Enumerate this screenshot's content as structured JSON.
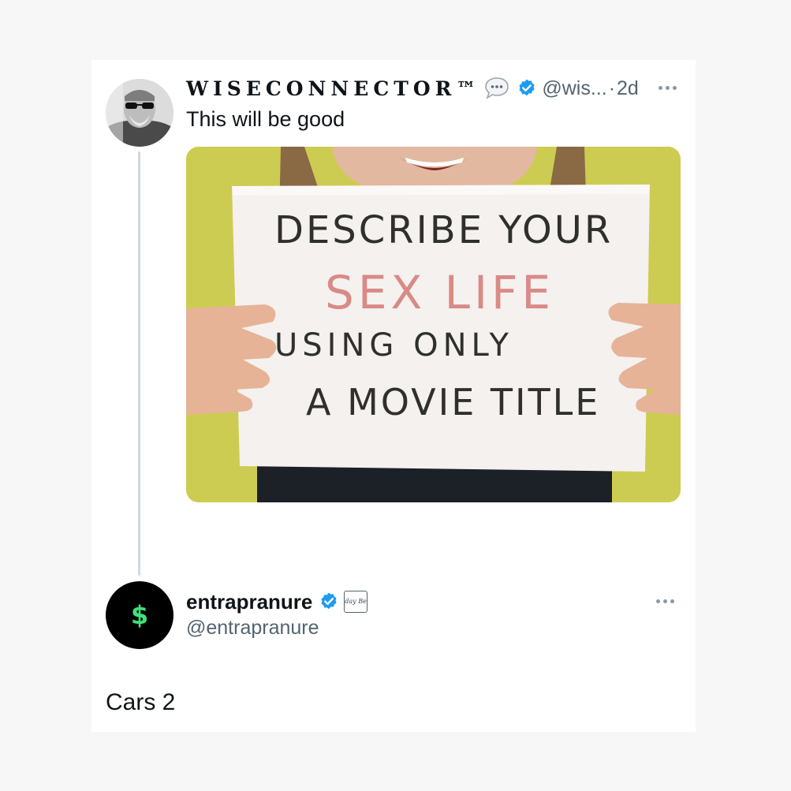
{
  "tweet": {
    "author": {
      "display_name": "WISECONNECTOR™",
      "handle": "@wis...",
      "separator": "·",
      "time": "2d",
      "verified": true,
      "icons": [
        "speech-bubble-icon",
        "verified-badge-icon"
      ]
    },
    "text": "This will be good",
    "media": {
      "sign_lines": [
        "DESCRIBE YOUR",
        "SEX LIFE",
        "USING ONLY",
        "A MOVIE TITLE"
      ],
      "colors": {
        "background": "#c9c84f",
        "sign": "#f4f1ee",
        "ink_dark": "#2f302d",
        "ink_red": "#d98a88"
      }
    }
  },
  "reply": {
    "author": {
      "display_name": "entrapranure",
      "handle": "@entrapranure",
      "verified": true,
      "affiliate_badge_text": "Friday Beers",
      "avatar_symbol": "$"
    },
    "text": "Cars 2"
  },
  "colors": {
    "page_bg": "#f7f7f7",
    "card_bg": "#ffffff",
    "verified_blue": "#1d9bf0",
    "muted_text": "#536471",
    "thread_line": "#cfd9de",
    "avatar_green": "#3ee27a"
  }
}
